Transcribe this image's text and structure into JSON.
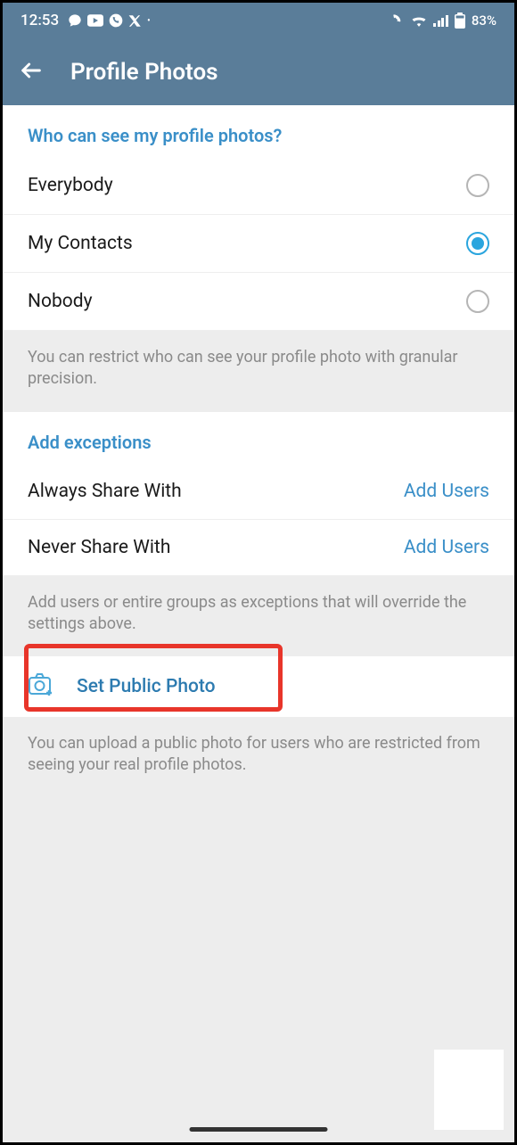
{
  "status": {
    "time": "12:53",
    "battery_pct": "83%"
  },
  "header": {
    "title": "Profile Photos"
  },
  "visibility": {
    "header": "Who can see my profile photos?",
    "options": [
      {
        "label": "Everybody",
        "selected": false
      },
      {
        "label": "My Contacts",
        "selected": true
      },
      {
        "label": "Nobody",
        "selected": false
      }
    ],
    "info": "You can restrict who can see your profile photo with granular precision."
  },
  "exceptions": {
    "header": "Add exceptions",
    "rows": [
      {
        "label": "Always Share With",
        "action": "Add Users"
      },
      {
        "label": "Never Share With",
        "action": "Add Users"
      }
    ],
    "info": "Add users or entire groups as exceptions that will override the settings above."
  },
  "public_photo": {
    "label": "Set Public Photo",
    "info": "You can upload a public photo for users who are restricted from seeing your real profile photos."
  }
}
